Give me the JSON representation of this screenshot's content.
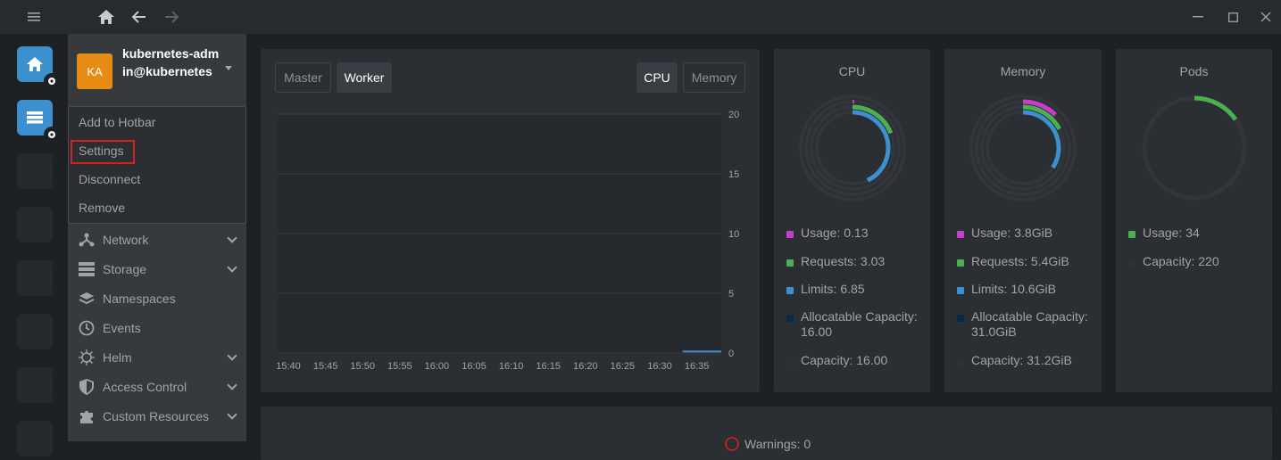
{
  "cluster": {
    "initials": "KA",
    "name": "kubernetes-admin@kubernetes"
  },
  "context_menu": {
    "items": [
      "Add to Hotbar",
      "Settings",
      "Disconnect",
      "Remove"
    ]
  },
  "sidebar": {
    "items": [
      {
        "label": "Network",
        "icon": "network-icon",
        "expandable": true
      },
      {
        "label": "Storage",
        "icon": "storage-icon",
        "expandable": true
      },
      {
        "label": "Namespaces",
        "icon": "layers-icon",
        "expandable": false
      },
      {
        "label": "Events",
        "icon": "clock-icon",
        "expandable": false
      },
      {
        "label": "Helm",
        "icon": "helm-icon",
        "expandable": true
      },
      {
        "label": "Access Control",
        "icon": "shield-icon",
        "expandable": true
      },
      {
        "label": "Custom Resources",
        "icon": "puzzle-icon",
        "expandable": true
      }
    ]
  },
  "metrics": {
    "node_tabs": [
      "Master",
      "Worker"
    ],
    "active_node_tab": "Worker",
    "resource_tabs": [
      "CPU",
      "Memory"
    ],
    "active_resource_tab": "CPU"
  },
  "chart_data": {
    "type": "line",
    "x": [
      "15:40",
      "15:45",
      "15:50",
      "15:55",
      "16:00",
      "16:05",
      "16:10",
      "16:15",
      "16:20",
      "16:25",
      "16:30",
      "16:35"
    ],
    "series": [
      {
        "values": [
          null,
          null,
          null,
          null,
          null,
          null,
          null,
          null,
          null,
          null,
          null,
          0.13
        ]
      }
    ],
    "yticks": [
      "0",
      "5",
      "10",
      "15",
      "20"
    ],
    "ylim": [
      0,
      20
    ],
    "grid": true,
    "color": "#3d90ce"
  },
  "cpu": {
    "title": "CPU",
    "legend": [
      {
        "label": "Usage: 0.13",
        "color": "#c93dce"
      },
      {
        "label": "Requests: 3.03",
        "color": "#4caf50"
      },
      {
        "label": "Limits: 6.85",
        "color": "#3d90ce"
      },
      {
        "label": "Allocatable Capacity: 16.00",
        "color": "#032b4d"
      },
      {
        "label": "Capacity: 16.00",
        "color": "#2e3136"
      }
    ]
  },
  "memory": {
    "title": "Memory",
    "legend": [
      {
        "label": "Usage: 3.8GiB",
        "color": "#c93dce"
      },
      {
        "label": "Requests: 5.4GiB",
        "color": "#4caf50"
      },
      {
        "label": "Limits: 10.6GiB",
        "color": "#3d90ce"
      },
      {
        "label": "Allocatable Capacity: 31.0GiB",
        "color": "#032b4d"
      },
      {
        "label": "Capacity: 31.2GiB",
        "color": "#2e3136"
      }
    ]
  },
  "pods": {
    "title": "Pods",
    "legend": [
      {
        "label": "Usage: 34",
        "color": "#4caf50"
      },
      {
        "label": "Capacity: 220",
        "color": "#2e3136"
      }
    ]
  },
  "warnings": {
    "title": "Warnings: 0"
  }
}
